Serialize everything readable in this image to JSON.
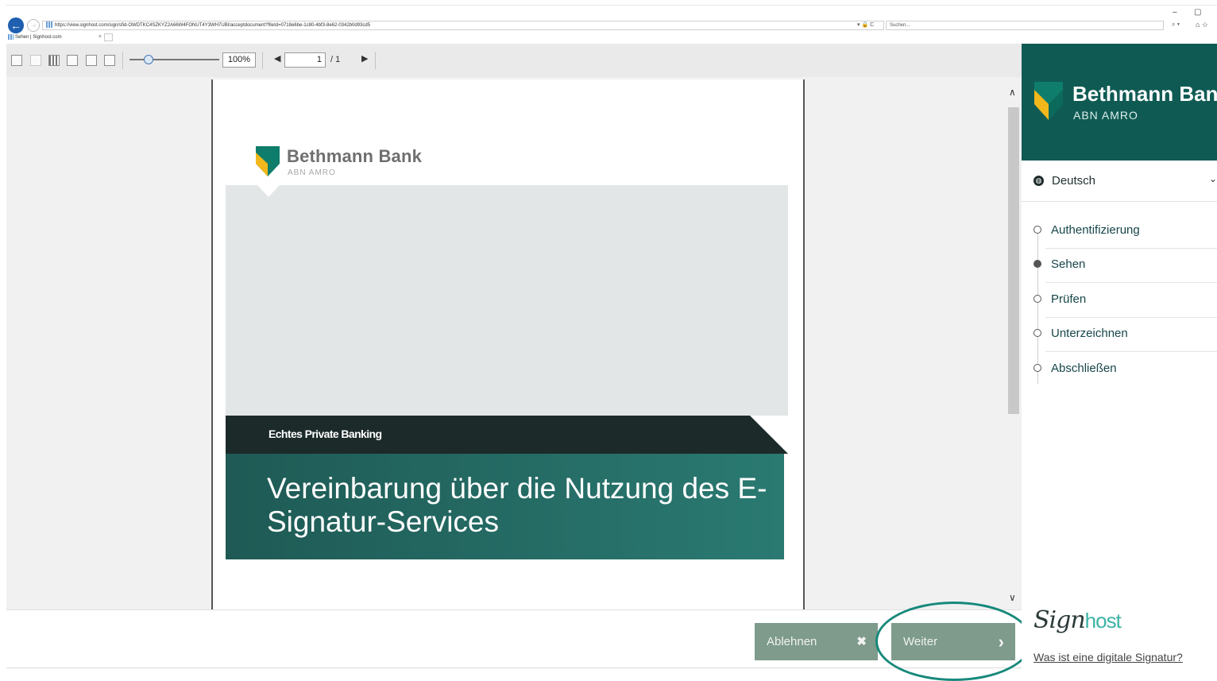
{
  "browser": {
    "url": "https://view.signhost.com/sign/sfid-OWDTKC4SZKYZ2A66W4FONUT4Y3WH7UBI/acceptdocument?fileId=0718e6be-1c80-4bf3-8e62-0342b0d93cd5",
    "address_controls": "▾ 🔒 C",
    "search_placeholder": "Suchen...",
    "search_icon": "search-icon",
    "tab_title": "Sehen | Signhost.com",
    "tab_close": "×",
    "win_minimize": "–",
    "win_restore": "▢"
  },
  "viewer": {
    "zoom": "100%",
    "page_current": "1",
    "page_total": "/ 1",
    "prev_glyph": "◀",
    "next_glyph": "▶",
    "scroll_up": "∧",
    "scroll_down": "∨"
  },
  "document": {
    "logo_name": "Bethmann Bank",
    "logo_sub": "ABN AMRO",
    "tagline": "Echtes Private Banking",
    "title": "Vereinbarung über die Nutzung des E-Signatur-Services"
  },
  "actions": {
    "decline_label": "Ablehnen",
    "decline_icon": "✖",
    "next_label": "Weiter",
    "next_icon": "›"
  },
  "sidebar": {
    "brand_name": "Bethmann Bank",
    "brand_sub": "ABN AMRO",
    "language": "Deutsch",
    "language_chevron": "⌄",
    "steps": [
      {
        "label": "Authentifizierung",
        "active": false
      },
      {
        "label": "Sehen",
        "active": true
      },
      {
        "label": "Prüfen",
        "active": false
      },
      {
        "label": "Unterzeichnen",
        "active": false
      },
      {
        "label": "Abschließen",
        "active": false
      }
    ],
    "signhost_logo_a": "Sign",
    "signhost_logo_b": "host",
    "help_link": "Was ist eine digitale Signatur?"
  },
  "colors": {
    "brand_green": "#0f5b54",
    "button_green": "#7e9b8b",
    "highlight_ring": "#17897b",
    "shield_yellow": "#f2b81b",
    "shield_green": "#0f7d6b"
  }
}
